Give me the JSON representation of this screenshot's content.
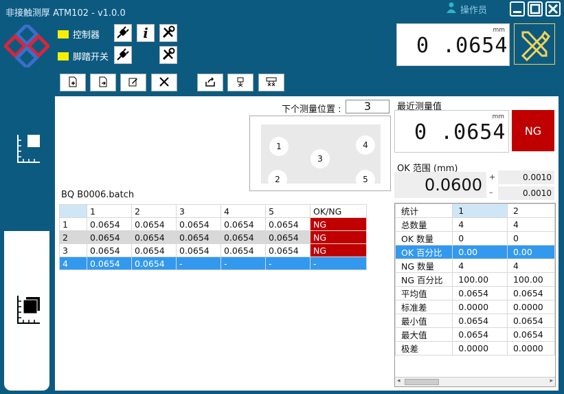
{
  "app": {
    "title": "非接触测厚 ATM102 - v1.0.0",
    "operator": "操作员"
  },
  "indicators": [
    {
      "label": "控制器",
      "color": "#f4f000"
    },
    {
      "label": "脚踏开关",
      "color": "#f4f000"
    }
  ],
  "top_display": {
    "value": "0 .0654",
    "unit": "mm"
  },
  "next_position": {
    "label": "下个测量位置 :",
    "value": "3"
  },
  "positions": [
    "1",
    "4",
    "3",
    "2",
    "5"
  ],
  "batch_name": "BQ B0006.batch",
  "measurements": {
    "columns": [
      "",
      "1",
      "2",
      "3",
      "4",
      "5",
      "OK/NG"
    ],
    "rows": [
      [
        "1",
        "0.0654",
        "0.0654",
        "0.0654",
        "0.0654",
        "0.0654",
        "NG"
      ],
      [
        "2",
        "0.0654",
        "0.0654",
        "0.0654",
        "0.0654",
        "0.0654",
        "NG"
      ],
      [
        "3",
        "0.0654",
        "0.0654",
        "0.0654",
        "0.0654",
        "0.0654",
        "NG"
      ],
      [
        "4",
        "0.0654",
        "0.0654",
        "-",
        "-",
        "-",
        "-"
      ]
    ]
  },
  "recent": {
    "label": "最近测量值",
    "value": "0 .0654",
    "unit": "mm",
    "status": "NG"
  },
  "ok_range": {
    "label": "OK 范围 (mm)",
    "nominal": "0.0600",
    "plus_sign": "+",
    "minus_sign": "–",
    "plus": "0.0010",
    "minus": "0.0010"
  },
  "stats": {
    "header": [
      "统计",
      "1",
      "2"
    ],
    "rows": [
      [
        "总数量",
        "4",
        "4"
      ],
      [
        "OK 数量",
        "0",
        "0"
      ],
      [
        "OK 百分比",
        "0.00",
        "0.00"
      ],
      [
        "NG 数量",
        "4",
        "4"
      ],
      [
        "NG 百分比",
        "100.00",
        "100.00"
      ],
      [
        "平均值",
        "0.0654",
        "0.0654"
      ],
      [
        "标准差",
        "0.0000",
        "0.0000"
      ],
      [
        "最小值",
        "0.0654",
        "0.0654"
      ],
      [
        "最大值",
        "0.0654",
        "0.0654"
      ],
      [
        "极差",
        "0.0000",
        "0.0000"
      ]
    ]
  },
  "colors": {
    "background": "#0d5a80",
    "ng": "#c00000",
    "selected": "#3399ee",
    "indicator": "#f4f000"
  }
}
